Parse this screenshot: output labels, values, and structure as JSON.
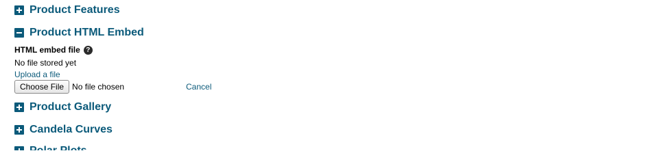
{
  "sections": {
    "features": {
      "title": "Product Features",
      "state": "collapsed"
    },
    "html_embed": {
      "title": "Product HTML Embed",
      "state": "expanded",
      "field_label": "HTML embed file",
      "help_glyph": "?",
      "status": "No file stored yet",
      "upload_link": "Upload a file",
      "choose_file_label": "Choose File",
      "file_chosen_text": "No file chosen",
      "cancel_link": "Cancel"
    },
    "gallery": {
      "title": "Product Gallery",
      "state": "collapsed"
    },
    "candela": {
      "title": "Candela Curves",
      "state": "collapsed"
    },
    "polar": {
      "title": "Polar Plots",
      "state": "collapsed"
    }
  },
  "colors": {
    "accent": "#0b5a7a",
    "help_icon_bg": "#2b2b2b"
  },
  "icons": {
    "collapsed": "plus-square-icon",
    "expanded": "minus-square-icon",
    "help": "help-circle-icon"
  }
}
